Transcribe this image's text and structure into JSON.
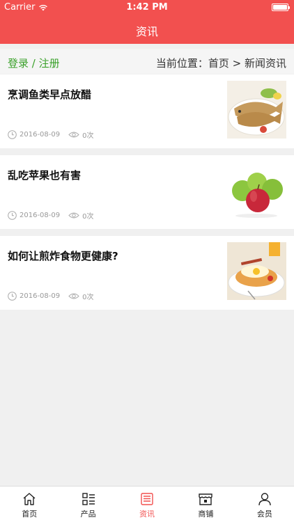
{
  "status_bar": {
    "carrier": "Carrier",
    "time": "1:42 PM"
  },
  "header": {
    "title": "资讯"
  },
  "crumb": {
    "login": "登录",
    "separator": " / ",
    "register": "注册",
    "location_label": "当前位置：",
    "home": "首页",
    "arrow": " > ",
    "current": "新闻资讯"
  },
  "articles": [
    {
      "title": "烹调鱼类早点放醋",
      "date": "2016-08-09",
      "views": "0次",
      "image_icon": "fish-dish-image"
    },
    {
      "title": "乱吃苹果也有害",
      "date": "2016-08-09",
      "views": "0次",
      "image_icon": "apples-image"
    },
    {
      "title": "如何让煎炸食物更健康?",
      "date": "2016-08-09",
      "views": "0次",
      "image_icon": "fried-food-image"
    }
  ],
  "tabbar": {
    "items": [
      {
        "label": "首页",
        "icon": "home-icon"
      },
      {
        "label": "产品",
        "icon": "grid-list-icon"
      },
      {
        "label": "资讯",
        "icon": "news-icon",
        "active": true
      },
      {
        "label": "商铺",
        "icon": "store-icon"
      },
      {
        "label": "会员",
        "icon": "user-icon"
      }
    ]
  },
  "colors": {
    "accent": "#f2504f",
    "link_green": "#3aa12a",
    "background": "#f0f0f0"
  }
}
